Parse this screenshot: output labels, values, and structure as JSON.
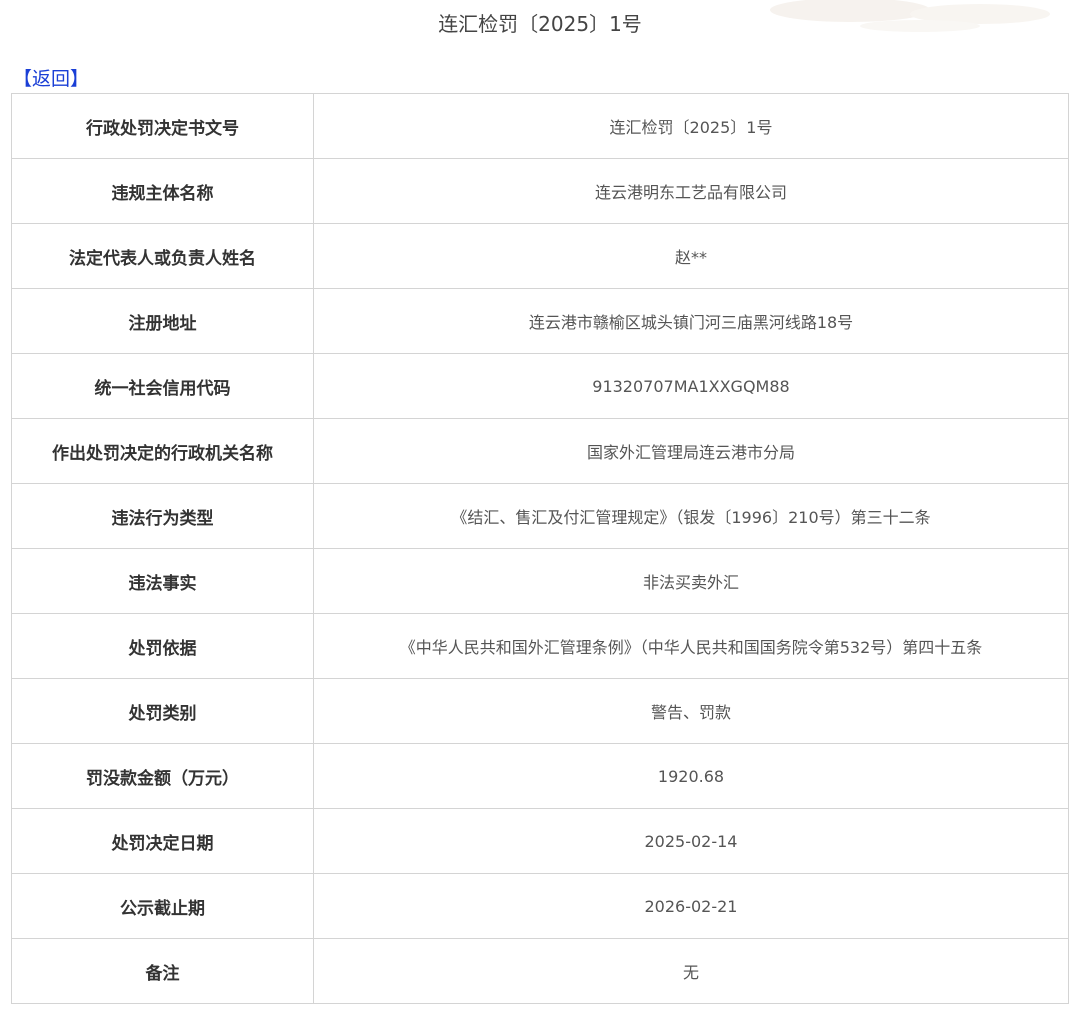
{
  "page": {
    "title": "连汇检罚〔2025〕1号",
    "back_label": "【返回】"
  },
  "colors": {
    "link": "#1a3fd6",
    "border": "#d4d4d4",
    "label_text": "#333333",
    "value_text": "#555555"
  },
  "rows": [
    {
      "label": "行政处罚决定书文号",
      "value": "连汇检罚〔2025〕1号"
    },
    {
      "label": "违规主体名称",
      "value": "连云港明东工艺品有限公司"
    },
    {
      "label": "法定代表人或负责人姓名",
      "value": "赵**"
    },
    {
      "label": "注册地址",
      "value": "连云港市赣榆区城头镇门河三庙黑河线路18号"
    },
    {
      "label": "统一社会信用代码",
      "value": "91320707MA1XXGQM88"
    },
    {
      "label": "作出处罚决定的行政机关名称",
      "value": "国家外汇管理局连云港市分局"
    },
    {
      "label": "违法行为类型",
      "value": "《结汇、售汇及付汇管理规定》（银发〔1996〕210号）第三十二条"
    },
    {
      "label": "违法事实",
      "value": "非法买卖外汇"
    },
    {
      "label": "处罚依据",
      "value": "《中华人民共和国外汇管理条例》（中华人民共和国国务院令第532号）第四十五条"
    },
    {
      "label": "处罚类别",
      "value": "警告、罚款"
    },
    {
      "label": "罚没款金额（万元）",
      "value": "1920.68"
    },
    {
      "label": "处罚决定日期",
      "value": "2025-02-14"
    },
    {
      "label": "公示截止期",
      "value": "2026-02-21"
    },
    {
      "label": "备注",
      "value": "无"
    }
  ]
}
